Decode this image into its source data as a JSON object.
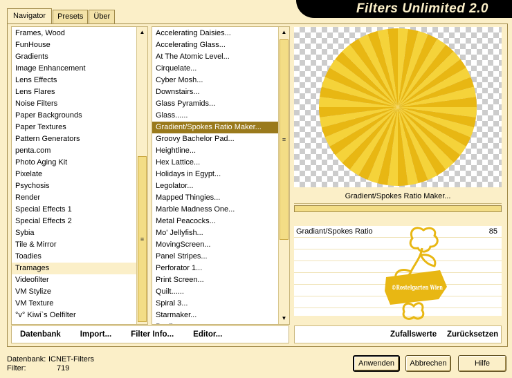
{
  "tabs": [
    "Navigator",
    "Presets",
    "Über"
  ],
  "app_title": "Filters Unlimited 2.0",
  "categories": [
    "Frames, Wood",
    "FunHouse",
    "Gradients",
    "Image Enhancement",
    "Lens Effects",
    "Lens Flares",
    "Noise Filters",
    "Paper Backgrounds",
    "Paper Textures",
    "Pattern Generators",
    "penta.com",
    "Photo Aging Kit",
    "Pixelate",
    "Psychosis",
    "Render",
    "Special Effects 1",
    "Special Effects 2",
    "Sybia",
    "Tile & Mirror",
    "Toadies",
    "Tramages",
    "Videofilter",
    "VM Stylize",
    "VM Texture",
    "°v° Kiwi`s Oelfilter"
  ],
  "selected_category": "Tramages",
  "filters": [
    "Accelerating Daisies...",
    "Accelerating Glass...",
    "At The Atomic Level...",
    "Cirquelate...",
    "Cyber Mosh...",
    "Downstairs...",
    "Glass Pyramids...",
    "Glass......",
    "Gradient/Spokes Ratio Maker...",
    "Groovy Bachelor Pad...",
    "Heightline...",
    "Hex Lattice...",
    "Holidays in Egypt...",
    "Legolator...",
    "Mapped Thingies...",
    "Marble Madness One...",
    "Metal Peacocks...",
    "Mo' Jellyfish...",
    "MovingScreen...",
    "Panel Stripes...",
    "Perforator 1...",
    "Print Screen...",
    "Quilt......",
    "Spiral 3...",
    "Starmaker...",
    "Pupil..."
  ],
  "selected_filter": "Gradient/Spokes Ratio Maker...",
  "bottom_buttons": {
    "datenbank": "Datenbank",
    "import": "Import...",
    "filter_info": "Filter Info...",
    "editor": "Editor..."
  },
  "preview_filter_name": "Gradient/Spokes Ratio Maker...",
  "params": [
    {
      "label": "Gradiant/Spokes Ratio",
      "value": "85"
    }
  ],
  "watermark": {
    "text": "©Rostelgarten Wien"
  },
  "right_buttons": {
    "zufallswerte": "Zufallswerte",
    "zuruecksetzen": "Zurücksetzen"
  },
  "status": {
    "datenbank_label": "Datenbank:",
    "datenbank_value": "ICNET-Filters",
    "filter_label": "Filter:",
    "filter_value": "719"
  },
  "dialog_buttons": {
    "anwenden": "Anwenden",
    "abbrechen": "Abbrechen",
    "hilfe": "Hilfe"
  },
  "colors": {
    "accent": "#9a7a1c",
    "panel": "#fbefc8",
    "spokes_light": "#f5d33a",
    "spokes_dark": "#e8b713"
  }
}
